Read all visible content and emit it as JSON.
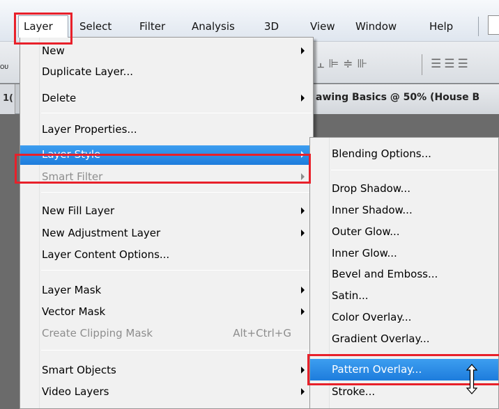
{
  "menubar": {
    "items": [
      "Layer",
      "Select",
      "Filter",
      "Analysis",
      "3D",
      "View",
      "Window",
      "Help"
    ]
  },
  "options_bar": {
    "left_text": "OU"
  },
  "document": {
    "left_fragment": "1(",
    "tab_title": "awing Basics @ 50% (House B"
  },
  "layer_menu": {
    "items": [
      {
        "label": "New",
        "submenu": true
      },
      {
        "label": "Duplicate Layer..."
      },
      {
        "label": "Delete",
        "submenu": true
      },
      {
        "label": "Layer Properties..."
      },
      {
        "label": "Layer Style",
        "submenu": true,
        "active": true
      },
      {
        "label": "Smart Filter",
        "submenu": true,
        "disabled": true
      },
      {
        "label": "New Fill Layer",
        "submenu": true
      },
      {
        "label": "New Adjustment Layer",
        "submenu": true
      },
      {
        "label": "Layer Content Options..."
      },
      {
        "label": "Layer Mask",
        "submenu": true
      },
      {
        "label": "Vector Mask",
        "submenu": true
      },
      {
        "label": "Create Clipping Mask",
        "shortcut": "Alt+Ctrl+G",
        "disabled": true
      },
      {
        "label": "Smart Objects",
        "submenu": true
      },
      {
        "label": "Video Layers",
        "submenu": true
      }
    ]
  },
  "layer_style_submenu": {
    "items": [
      {
        "label": "Blending Options..."
      },
      {
        "label": "Drop Shadow..."
      },
      {
        "label": "Inner Shadow..."
      },
      {
        "label": "Outer Glow..."
      },
      {
        "label": "Inner Glow..."
      },
      {
        "label": "Bevel and Emboss..."
      },
      {
        "label": "Satin..."
      },
      {
        "label": "Color Overlay..."
      },
      {
        "label": "Gradient Overlay..."
      },
      {
        "label": "Pattern Overlay...",
        "active": true
      },
      {
        "label": "Stroke..."
      }
    ]
  },
  "colors": {
    "highlight_frame": "#e8202a",
    "menu_selection": "#2a8ae6"
  }
}
